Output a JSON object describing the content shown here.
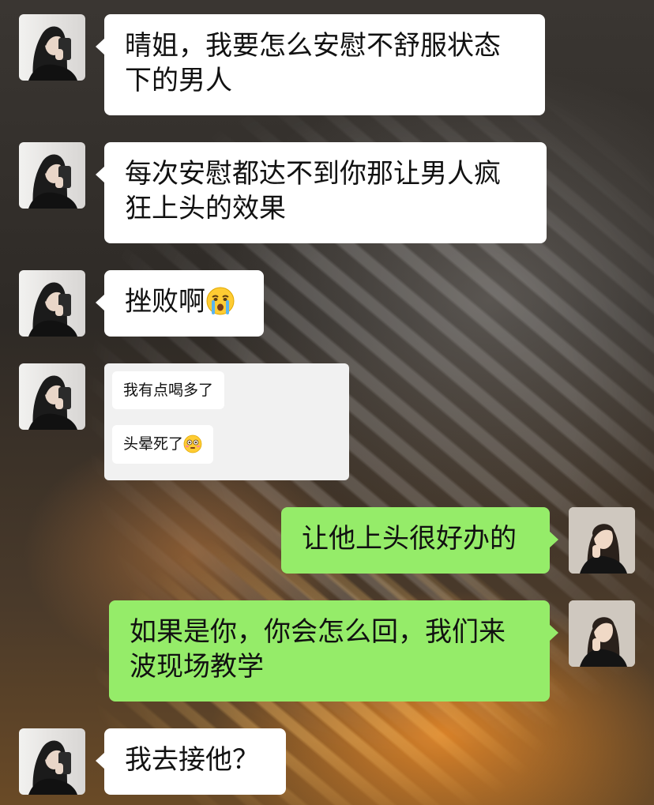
{
  "conversation": {
    "messages": [
      {
        "sender": "contact",
        "text": "晴姐，我要怎么安慰不舒服状态\n下的男人"
      },
      {
        "sender": "contact",
        "text": "每次安慰都达不到你那让男人疯\n狂上头的效果"
      },
      {
        "sender": "contact",
        "text": "挫败啊",
        "emoji": "crying-face-icon"
      },
      {
        "sender": "contact",
        "type": "screenshot-card",
        "items": [
          {
            "text": "我有点喝多了"
          },
          {
            "text": "头晕死了",
            "emoji": "flushed-face-icon"
          }
        ]
      },
      {
        "sender": "me",
        "text": "让他上头很好办的"
      },
      {
        "sender": "me",
        "text": "如果是你，你会怎么回，我们来\n波现场教学"
      },
      {
        "sender": "contact",
        "text": "我去接他？"
      }
    ]
  },
  "colors": {
    "incoming_bubble": "#ffffff",
    "outgoing_bubble": "#95ec69",
    "card_background": "#f1f1f1"
  }
}
